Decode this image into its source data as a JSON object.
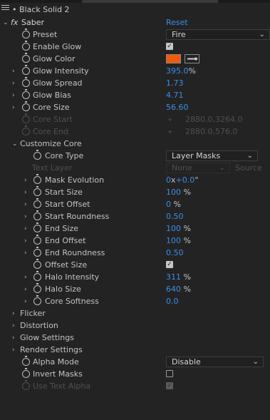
{
  "panel": {
    "title": "Black Solid 2"
  },
  "effect": {
    "fx": "fx",
    "name": "Saber",
    "reset": "Reset"
  },
  "props": {
    "preset": {
      "label": "Preset",
      "value": "Fire"
    },
    "enable_glow": {
      "label": "Enable Glow",
      "checked": true
    },
    "glow_color": {
      "label": "Glow Color",
      "swatch": "#f05a0a"
    },
    "glow_intensity": {
      "label": "Glow Intensity",
      "value": "395.0",
      "unit": "%"
    },
    "glow_spread": {
      "label": "Glow Spread",
      "value": "1.73"
    },
    "glow_bias": {
      "label": "Glow Bias",
      "value": "4.71"
    },
    "core_size": {
      "label": "Core Size",
      "value": "56.60"
    },
    "core_start": {
      "label": "Core Start",
      "value": "2880.0,3264.0"
    },
    "core_end": {
      "label": "Core End",
      "value": "2880.0,576.0"
    }
  },
  "customize_core": {
    "label": "Customize Core",
    "core_type": {
      "label": "Core Type",
      "value": "Layer Masks"
    },
    "text_layer": {
      "label": "Text Layer",
      "value": "None",
      "source": "Source"
    },
    "mask_evolution": {
      "label": "Mask Evolution",
      "value": "0",
      "x": "x",
      "value2": "+0.0",
      "unit": "°"
    },
    "start_size": {
      "label": "Start Size",
      "value": "100",
      "unit": "%"
    },
    "start_offset": {
      "label": "Start Offset",
      "value": "0",
      "unit": "%"
    },
    "start_roundness": {
      "label": "Start Roundness",
      "value": "0.50"
    },
    "end_size": {
      "label": "End Size",
      "value": "100",
      "unit": "%"
    },
    "end_offset": {
      "label": "End Offset",
      "value": "100",
      "unit": "%"
    },
    "end_roundness": {
      "label": "End Roundness",
      "value": "0.50"
    },
    "offset_size": {
      "label": "Offset Size",
      "checked": true
    },
    "halo_intensity": {
      "label": "Halo Intensity",
      "value": "311",
      "unit": "%"
    },
    "halo_size": {
      "label": "Halo Size",
      "value": "640",
      "unit": "%"
    },
    "core_softness": {
      "label": "Core Softness",
      "value": "0.0"
    }
  },
  "groups": {
    "flicker": "Flicker",
    "distortion": "Distortion",
    "glow_settings": "Glow Settings",
    "render_settings": "Render Settings"
  },
  "bottom": {
    "alpha_mode": {
      "label": "Alpha Mode",
      "value": "Disable"
    },
    "invert_masks": {
      "label": "Invert Masks",
      "checked": false
    },
    "use_text_alpha": {
      "label": "Use Text Alpha",
      "checked": true
    }
  },
  "glyphs": {
    "chev_right": "›",
    "chev_down": "⌄",
    "check": "✓"
  }
}
